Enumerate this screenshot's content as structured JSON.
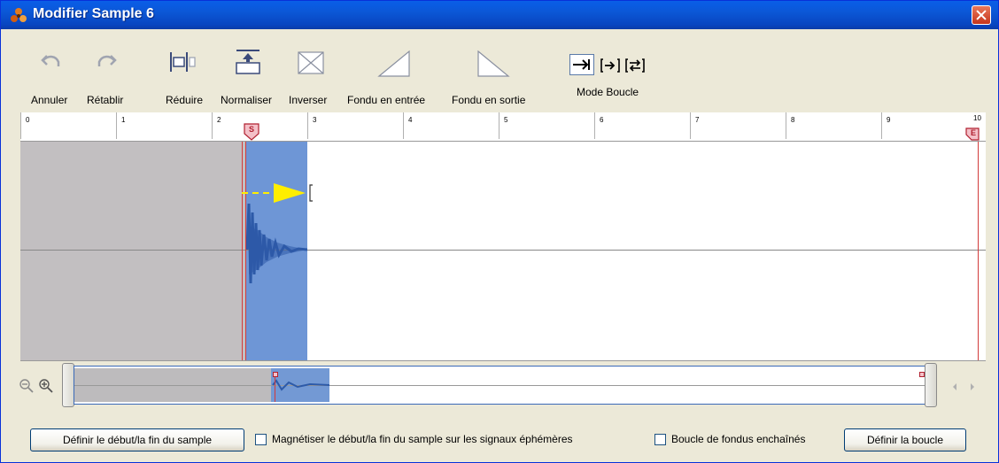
{
  "window": {
    "title": "Modifier Sample 6",
    "accent": "#0a5ee8"
  },
  "toolbar": {
    "undo_label": "Annuler",
    "redo_label": "Rétablir",
    "trim_label": "Réduire",
    "normalize_label": "Normaliser",
    "reverse_label": "Inverser",
    "fade_in_label": "Fondu en entrée",
    "fade_out_label": "Fondu en sortie",
    "loop_mode_label": "Mode Boucle"
  },
  "ruler": {
    "ticks": [
      "0",
      "1",
      "2",
      "3",
      "4",
      "5",
      "6",
      "7",
      "8",
      "9",
      "10"
    ],
    "start_marker": "S",
    "end_marker": "E"
  },
  "colors": {
    "selection": "#6e96d6",
    "trimmed": "#c2bfc1",
    "marker": "#d23b3b",
    "arrow": "#ffee00"
  },
  "bottom": {
    "set_start_end_button": "Définir le début/la fin du sample",
    "magnetize_label": "Magnétiser le début/la fin du sample sur les signaux éphémères",
    "magnetize_checked": false,
    "crossfade_loop_label": "Boucle de fondus enchaînés",
    "crossfade_loop_checked": false,
    "set_loop_button": "Définir la boucle"
  }
}
